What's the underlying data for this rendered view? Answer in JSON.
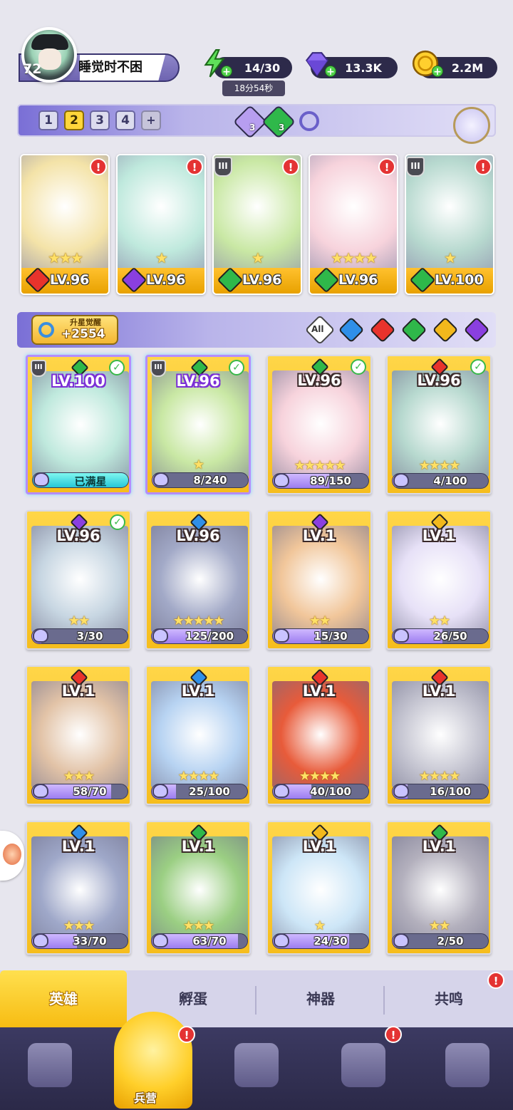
{
  "player": {
    "level": "72",
    "name": "睡觉时不困"
  },
  "resources": {
    "energy": "14/30",
    "energy_timer": "18分54秒",
    "gems": "13.3K",
    "gold": "2.2M"
  },
  "team_tabs": [
    "1",
    "2",
    "3",
    "4",
    "+"
  ],
  "active_team_tab": "2",
  "team_counters": {
    "purple": "3",
    "green": "3"
  },
  "team": [
    {
      "level": "LV.96",
      "element": "fire",
      "stars": "★★★",
      "alert": "!",
      "rank": ""
    },
    {
      "level": "LV.96",
      "element": "dark",
      "stars": "★",
      "alert": "!",
      "rank": ""
    },
    {
      "level": "LV.96",
      "element": "wind",
      "stars": "★",
      "alert": "!",
      "rank": "III"
    },
    {
      "level": "LV.96",
      "element": "wind",
      "stars": "★★★★",
      "alert": "!",
      "rank": ""
    },
    {
      "level": "LV.100",
      "element": "wind",
      "stars": "★",
      "alert": "!",
      "rank": "III"
    }
  ],
  "awaken": {
    "label": "升星觉醒",
    "value": "+2554"
  },
  "filters": {
    "all": "All",
    "elements": [
      "water",
      "fire",
      "wind",
      "light",
      "dark"
    ]
  },
  "heroes": [
    {
      "level": "LV.100",
      "element": "wind",
      "progress": "已满星",
      "ratio": 1.0,
      "maxed": true,
      "checked": true,
      "rank": "III",
      "selected": true,
      "stars": ""
    },
    {
      "level": "LV.96",
      "element": "wind",
      "progress": "8/240",
      "ratio": 0.03,
      "checked": true,
      "rank": "III",
      "selected": true,
      "stars": "★"
    },
    {
      "level": "LV.96",
      "element": "wind",
      "progress": "89/150",
      "ratio": 0.59,
      "checked": true,
      "stars": "★★★★★"
    },
    {
      "level": "LV.96",
      "element": "fire",
      "progress": "4/100",
      "ratio": 0.04,
      "checked": true,
      "stars": "★★★★"
    },
    {
      "level": "LV.96",
      "element": "dark",
      "progress": "3/30",
      "ratio": 0.1,
      "checked": true,
      "stars": "★★"
    },
    {
      "level": "LV.96",
      "element": "water",
      "progress": "125/200",
      "ratio": 0.62,
      "stars": "★★★★★"
    },
    {
      "level": "LV.1",
      "element": "dark",
      "progress": "15/30",
      "ratio": 0.5,
      "stars": "★★"
    },
    {
      "level": "LV.1",
      "element": "light",
      "progress": "26/50",
      "ratio": 0.52,
      "stars": "★★"
    },
    {
      "level": "LV.1",
      "element": "fire",
      "progress": "58/70",
      "ratio": 0.83,
      "stars": "★★★"
    },
    {
      "level": "LV.1",
      "element": "water",
      "progress": "25/100",
      "ratio": 0.25,
      "stars": "★★★★"
    },
    {
      "level": "LV.1",
      "element": "fire",
      "progress": "40/100",
      "ratio": 0.4,
      "stars": "★★★★"
    },
    {
      "level": "LV.1",
      "element": "fire",
      "progress": "16/100",
      "ratio": 0.16,
      "stars": "★★★★"
    },
    {
      "level": "LV.1",
      "element": "water",
      "progress": "33/70",
      "ratio": 0.47,
      "stars": "★★★"
    },
    {
      "level": "LV.1",
      "element": "wind",
      "progress": "63/70",
      "ratio": 0.9,
      "stars": "★★★"
    },
    {
      "level": "LV.1",
      "element": "light",
      "progress": "24/30",
      "ratio": 0.8,
      "stars": "★"
    },
    {
      "level": "LV.1",
      "element": "wind",
      "progress": "2/50",
      "ratio": 0.04,
      "stars": "★★"
    }
  ],
  "subtabs": [
    "英雄",
    "孵蛋",
    "神器",
    "共鸣"
  ],
  "subtab_alert": "!",
  "nav": {
    "active_label": "兵营",
    "alert": "!"
  },
  "element_colors": {
    "fire": "#e8332c",
    "water": "#2f8fe8",
    "wind": "#2fb84a",
    "light": "#f2b81c",
    "dark": "#8a3fe0"
  },
  "art_colors": [
    "#f4e3a8",
    "#bfe9dd",
    "#c9e8a4",
    "#f7d3dc",
    "#b7d9cf",
    "#c7d6e2",
    "#a2a9c7",
    "#f1c69a",
    "#e7e1f7",
    "#e2c3a7",
    "#b7d3f2",
    "#e85b3a",
    "#c6c6d2",
    "#9fa8c9",
    "#9bcf83",
    "#cde6f7",
    "#b3b0bd"
  ]
}
